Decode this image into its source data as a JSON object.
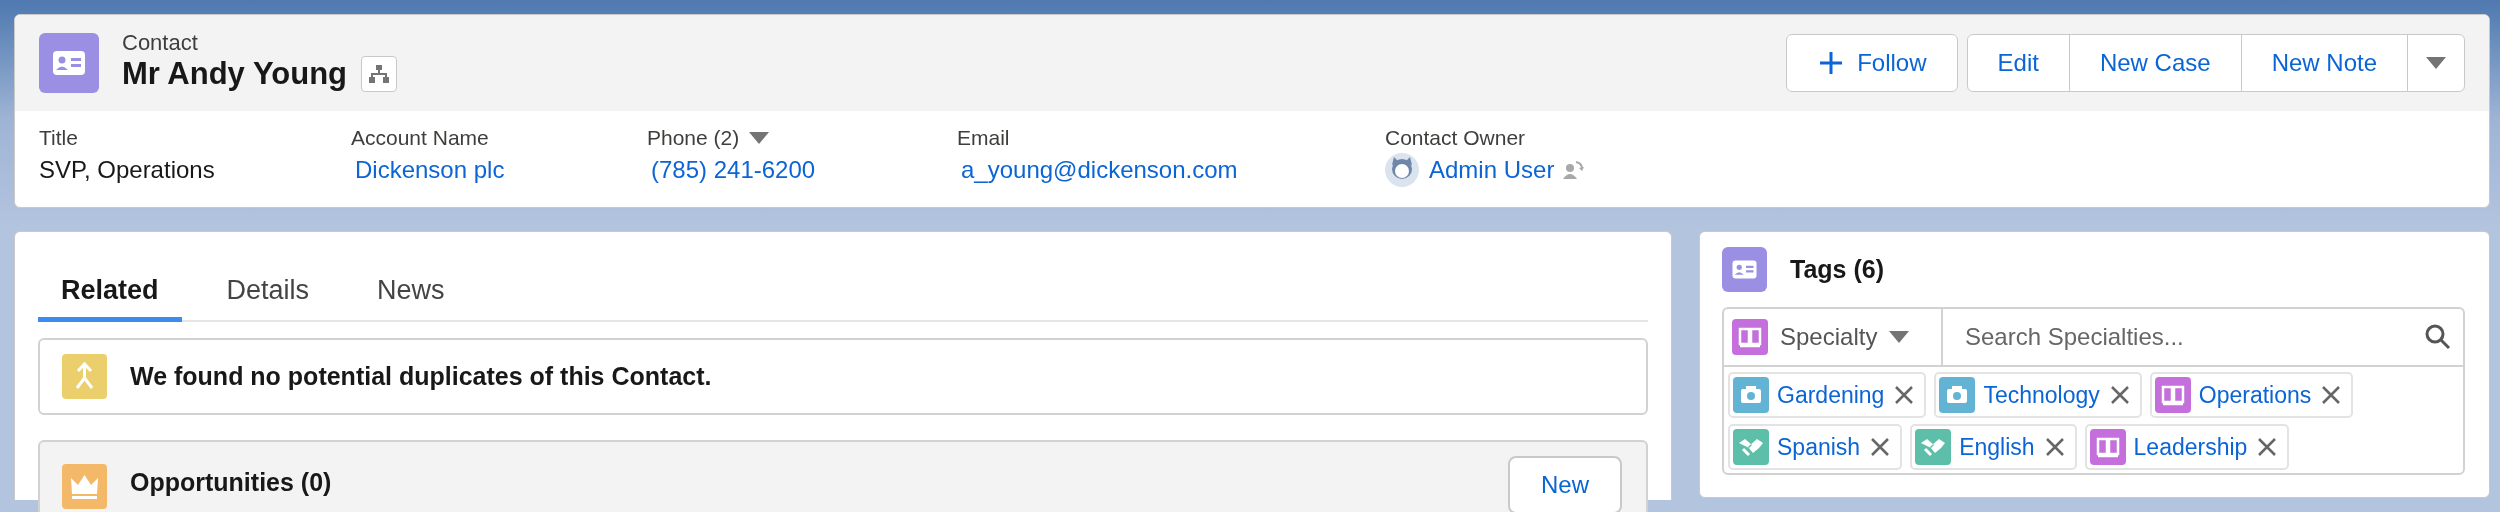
{
  "record": {
    "type": "Contact",
    "name": "Mr Andy Young"
  },
  "actions": {
    "follow": "Follow",
    "buttons": [
      "Edit",
      "New Case",
      "New Note"
    ]
  },
  "fields": [
    {
      "label": "Title",
      "value": "SVP, Operations",
      "kind": "text",
      "dropdown": false
    },
    {
      "label": "Account Name",
      "value": "Dickenson plc",
      "kind": "link",
      "dropdown": false
    },
    {
      "label": "Phone (2)",
      "value": "(785) 241-6200",
      "kind": "link",
      "dropdown": true
    },
    {
      "label": "Email",
      "value": "a_young@dickenson.com",
      "kind": "link",
      "dropdown": false
    },
    {
      "label": "Contact Owner",
      "value": "Admin User",
      "kind": "user",
      "dropdown": false
    }
  ],
  "tabs": [
    {
      "label": "Related",
      "selected": true
    },
    {
      "label": "Details",
      "selected": false
    },
    {
      "label": "News",
      "selected": false
    }
  ],
  "duplicates": {
    "message": "We found no potential duplicates of this Contact."
  },
  "opportunities": {
    "title": "Opportunities (0)",
    "button": "New"
  },
  "tags_panel": {
    "title": "Tags (6)",
    "filter": "Specialty",
    "search": {
      "placeholder": "Search Specialties..."
    },
    "tags": [
      {
        "label": "Gardening",
        "kind": "camera"
      },
      {
        "label": "Technology",
        "kind": "camera"
      },
      {
        "label": "Operations",
        "kind": "book"
      },
      {
        "label": "Spanish",
        "kind": "handshake"
      },
      {
        "label": "English",
        "kind": "handshake"
      },
      {
        "label": "Leadership",
        "kind": "book"
      }
    ]
  }
}
